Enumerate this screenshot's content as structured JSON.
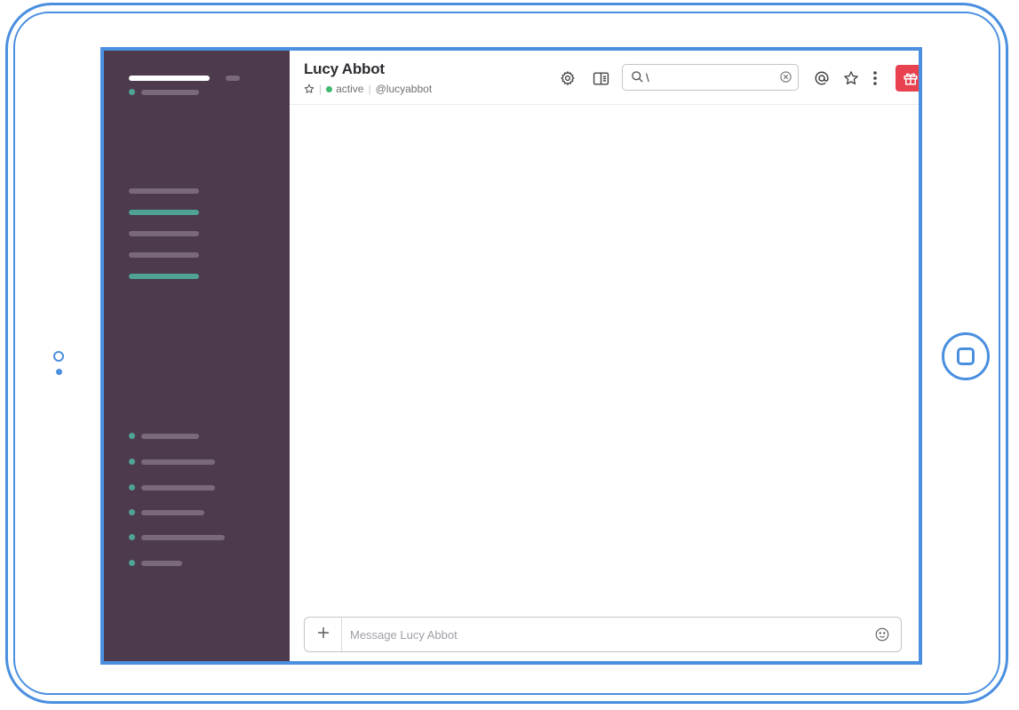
{
  "channel": {
    "name": "Lucy Abbot",
    "status": "active",
    "handle": "@lucyabbot"
  },
  "search": {
    "value": "\\"
  },
  "composer": {
    "placeholder": "Message Lucy Abbot"
  },
  "icons": {
    "star": "star-icon",
    "settings": "gear-icon",
    "details": "sidebar-panel-icon",
    "search": "search-icon",
    "clear": "clear-icon",
    "mentions": "at-icon",
    "starred": "star-icon",
    "more": "more-vertical-icon",
    "gift": "gift-icon",
    "add": "plus-icon",
    "emoji": "emoji-icon"
  },
  "colors": {
    "sidebar": "#4d3a4c",
    "accent_teal": "#4fa294",
    "presence": "#3fb96b",
    "gift": "#e8414f",
    "device_outline": "#4a8fe0"
  }
}
